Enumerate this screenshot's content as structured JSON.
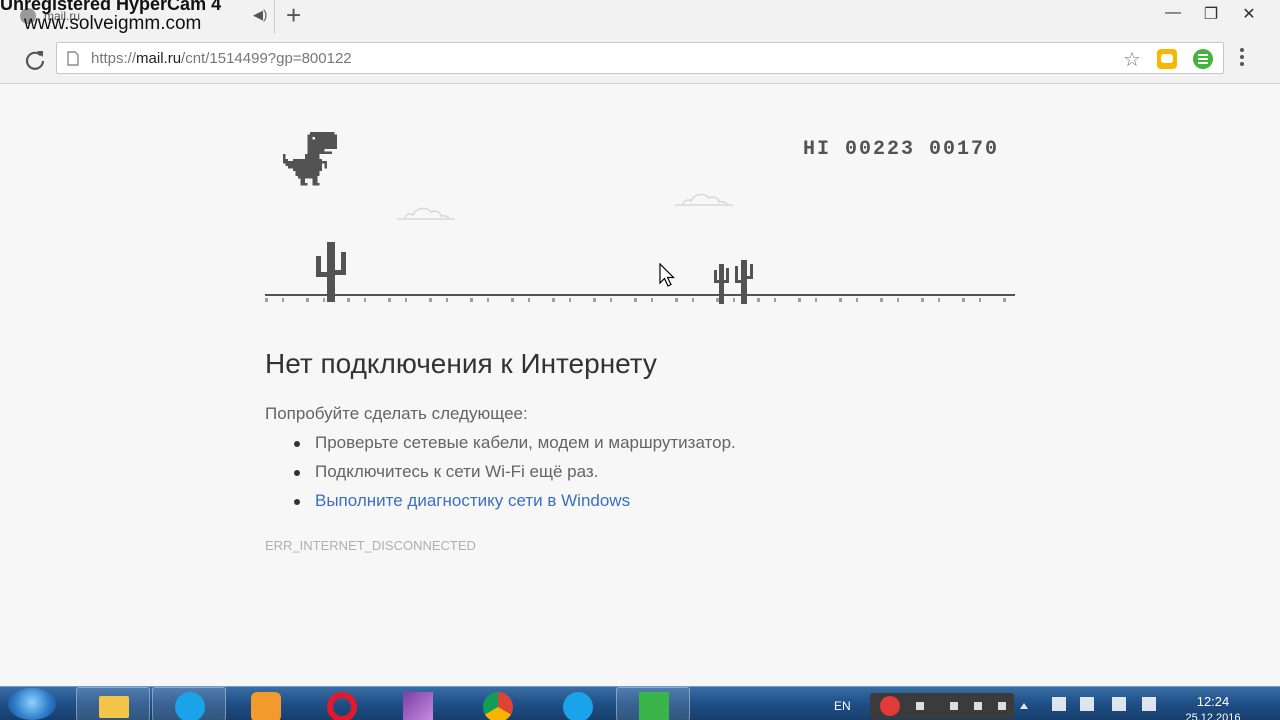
{
  "watermark": {
    "line1": "Unregistered HyperCam 4",
    "line2": "www.solveigmm.com"
  },
  "tab": {
    "title": "mail.ru"
  },
  "newtab_glyph": "+",
  "window_controls": {
    "minimize": "—",
    "restore": "❐",
    "close": "✕"
  },
  "address_bar": {
    "scheme": "https://",
    "host": "mail.ru",
    "path": "/cnt/1514499?gp=800122"
  },
  "toolbar_icons": [
    "reload-icon",
    "page-icon",
    "star-icon",
    "extension-chat-icon",
    "extension-list-icon",
    "menu-icon"
  ],
  "game": {
    "score": "HI 00223 00170"
  },
  "error": {
    "title": "Нет подключения к Интернету",
    "subtitle": "Попробуйте сделать следующее:",
    "suggestions": [
      "Проверьте сетевые кабели, модем и маршрутизатор.",
      "Подключитесь к сети Wi-Fi ещё раз."
    ],
    "diagnostics_link": "Выполните диагностику сети в Windows",
    "code": "ERR_INTERNET_DISCONNECTED"
  },
  "taskbar": {
    "apps": [
      "explorer-icon",
      "skype-icon",
      "media-player-icon",
      "opera-icon",
      "winrar-icon",
      "chrome-icon",
      "skype-icon",
      "android-icon"
    ],
    "language": "EN",
    "time": "12:24",
    "date": "25.12.2016"
  },
  "colors": {
    "link": "#3b6fc3",
    "dino": "#535353",
    "taskbar": "#1f4f86"
  }
}
